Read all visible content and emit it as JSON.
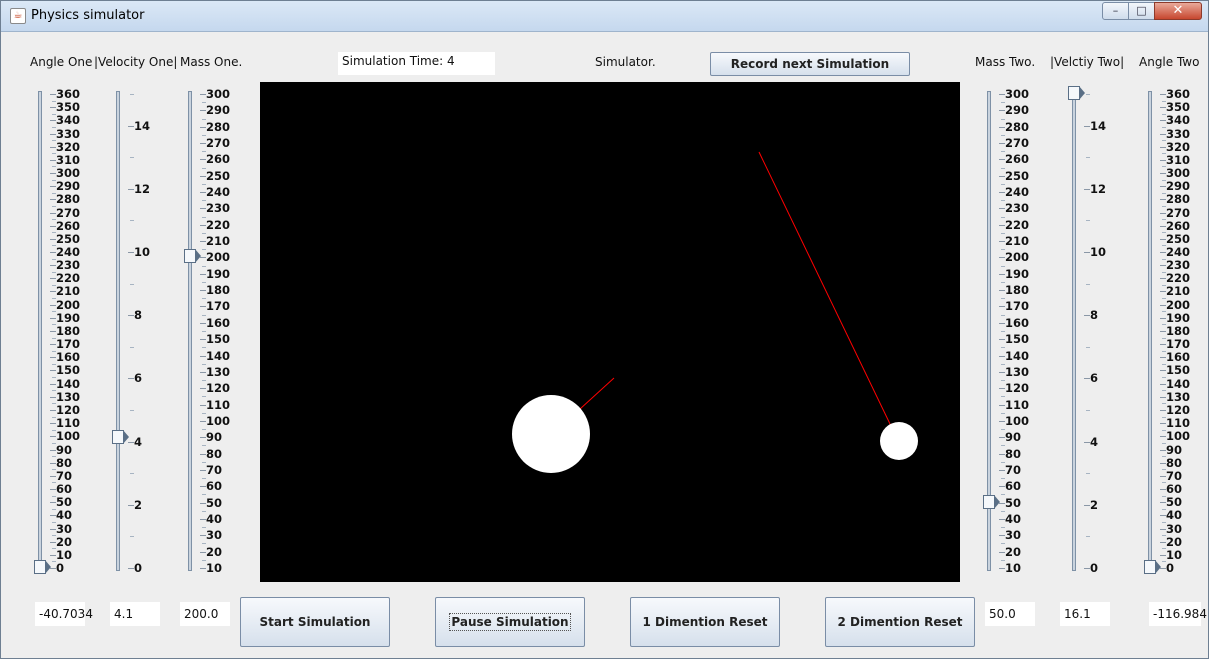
{
  "window": {
    "title": "Physics simulator",
    "icon": "java-cup-icon",
    "controls": {
      "minimize": "–",
      "maximize": "□",
      "close": "✕"
    }
  },
  "header": {
    "simulation_time": "Simulation Time: 4",
    "simulator_label": "Simulator.",
    "record_button": "Record next Simulation"
  },
  "sliders": {
    "angle_one": {
      "label": "Angle One",
      "min": 0,
      "max": 360,
      "major": 10,
      "minor": 5,
      "value": 0,
      "ticks": [
        "0",
        "10",
        "20",
        "30",
        "40",
        "50",
        "60",
        "70",
        "80",
        "90",
        "100",
        "110",
        "120",
        "130",
        "140",
        "150",
        "160",
        "170",
        "180",
        "190",
        "200",
        "210",
        "220",
        "230",
        "240",
        "250",
        "260",
        "270",
        "280",
        "290",
        "300",
        "310",
        "320",
        "330",
        "340",
        "350",
        "360"
      ]
    },
    "velocity_one": {
      "label": "|Velocity One|",
      "min": 0,
      "max": 15,
      "major": 2,
      "minor": 1,
      "value": 4.1,
      "ticks": [
        "0",
        "2",
        "4",
        "6",
        "8",
        "10",
        "12",
        "14"
      ]
    },
    "mass_one": {
      "label": "Mass One.",
      "min": 10,
      "max": 300,
      "major": 10,
      "minor": 5,
      "value": 200,
      "ticks": [
        "10",
        "20",
        "30",
        "40",
        "50",
        "60",
        "70",
        "80",
        "90",
        "100",
        "110",
        "120",
        "130",
        "140",
        "150",
        "160",
        "170",
        "180",
        "190",
        "200",
        "210",
        "220",
        "230",
        "240",
        "250",
        "260",
        "270",
        "280",
        "290",
        "300"
      ]
    },
    "mass_two": {
      "label": "Mass Two.",
      "min": 10,
      "max": 300,
      "major": 10,
      "minor": 5,
      "value": 50,
      "ticks": [
        "10",
        "20",
        "30",
        "40",
        "50",
        "60",
        "70",
        "80",
        "90",
        "100",
        "110",
        "120",
        "130",
        "140",
        "150",
        "160",
        "170",
        "180",
        "190",
        "200",
        "210",
        "220",
        "230",
        "240",
        "250",
        "260",
        "270",
        "280",
        "290",
        "300"
      ]
    },
    "velocity_two": {
      "label": "|Velctiy Two|",
      "min": 0,
      "max": 15,
      "major": 2,
      "minor": 1,
      "value": 15,
      "ticks": [
        "0",
        "2",
        "4",
        "6",
        "8",
        "10",
        "12",
        "14"
      ]
    },
    "angle_two": {
      "label": "Angle Two",
      "min": 0,
      "max": 360,
      "major": 10,
      "minor": 5,
      "value": 0,
      "ticks": [
        "0",
        "10",
        "20",
        "30",
        "40",
        "50",
        "60",
        "70",
        "80",
        "90",
        "100",
        "110",
        "120",
        "130",
        "140",
        "150",
        "160",
        "170",
        "180",
        "190",
        "200",
        "210",
        "220",
        "230",
        "240",
        "250",
        "260",
        "270",
        "280",
        "290",
        "300",
        "310",
        "320",
        "330",
        "340",
        "350",
        "360"
      ]
    }
  },
  "fields": {
    "angle_one": "-40.7034",
    "velocity_one": "4.1",
    "mass_one": "200.0",
    "mass_two": "50.0",
    "velocity_two": "16.1",
    "angle_two": "-116.984"
  },
  "buttons": {
    "start": "Start Simulation",
    "pause": "Pause Simulation",
    "reset_1d": "1 Dimention Reset",
    "reset_2d": "2 Dimention Reset"
  },
  "colors": {
    "canvas_bg": "#000000",
    "ball": "#ffffff",
    "trail": "#ff0000"
  }
}
